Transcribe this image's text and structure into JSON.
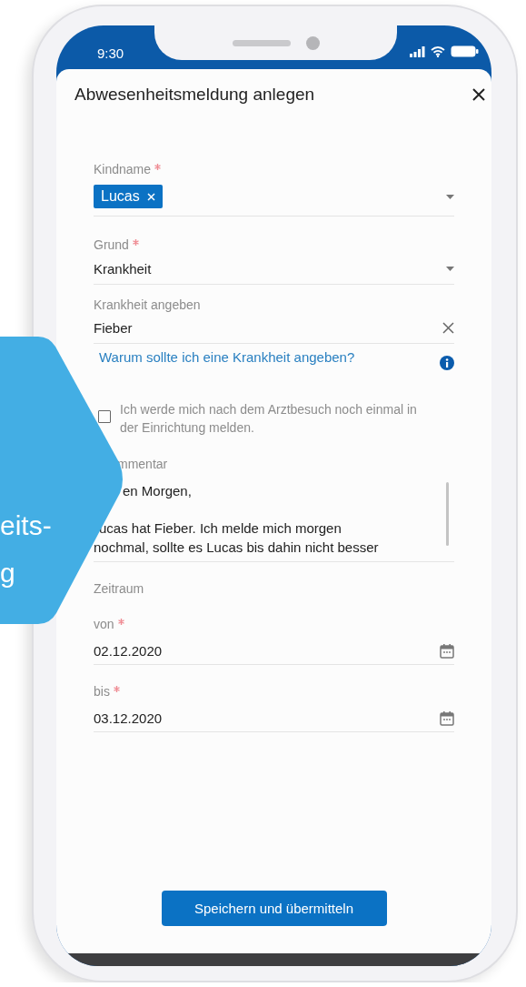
{
  "status_bar": {
    "time": "9:30"
  },
  "title": "Abwesenheitsmeldung anlegen",
  "form": [
    {
      "kind": "chips",
      "label": "Kindname",
      "required": true,
      "chips": [
        "Lucas"
      ]
    },
    {
      "kind": "select",
      "label": "Grund",
      "required": true,
      "value": "Krankheit"
    },
    {
      "kind": "clearable",
      "label": "Krankheit angeben",
      "value": "Fieber"
    },
    {
      "kind": "link",
      "text": "Warum sollte ich eine Krankheit angeben?"
    },
    {
      "kind": "checkbox",
      "text": "Ich werde mich nach dem Arztbesuch noch einmal in der Einrichtung melden.",
      "checked": false
    },
    {
      "kind": "textarea",
      "label": "mmentar",
      "paragraphs": [
        [
          "en Morgen,"
        ],
        [
          "ucas hat Fieber. Ich melde mich morgen",
          "nochmal, sollte es Lucas bis dahin nicht besser"
        ]
      ]
    },
    {
      "kind": "section",
      "text": "Zeitraum"
    },
    {
      "kind": "date",
      "label": "von",
      "required": true,
      "value": "02.12.2020"
    },
    {
      "kind": "date",
      "label": "bis",
      "required": true,
      "value": "03.12.2020"
    }
  ],
  "submit_button": "Speichern und übermitteln",
  "badge": {
    "lines": [
      "eits-",
      "g"
    ]
  }
}
